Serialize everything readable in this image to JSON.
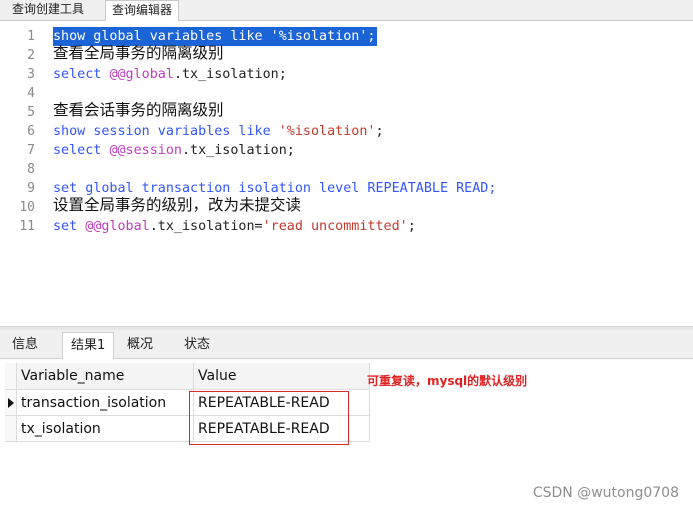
{
  "top_tabs": [
    "查询创建工具",
    "查询编辑器"
  ],
  "editor": {
    "line_numbers": [
      "1",
      "2",
      "3",
      "4",
      "5",
      "6",
      "7",
      "8",
      "9",
      "10",
      "11"
    ],
    "line1": "show global variables like '%isolation';",
    "line2": "查看全局事务的隔离级别",
    "line3": {
      "kw": "select ",
      "var": "@@global",
      "rest": ".tx_isolation;"
    },
    "line5": "查看会话事务的隔离级别",
    "line6": {
      "kw": "show session variables like ",
      "str": "'%isolation'",
      "rest": ";"
    },
    "line7": {
      "kw": "select ",
      "var": "@@session",
      "rest": ".tx_isolation;"
    },
    "line9": "set global transaction isolation level REPEATABLE READ;",
    "line10": "设置全局事务的级别，改为未提交读",
    "line11": {
      "kw": "set ",
      "var": "@@global",
      "rest": ".tx_isolation=",
      "str": "'read uncommitted'",
      "end": ";"
    }
  },
  "result_tabs": [
    "信息",
    "结果1",
    "概况",
    "状态"
  ],
  "result_grid": {
    "headers": [
      "Variable_name",
      "Value"
    ],
    "rows": [
      [
        "transaction_isolation",
        "REPEATABLE-READ"
      ],
      [
        "tx_isolation",
        "REPEATABLE-READ"
      ]
    ]
  },
  "annotation": "可重复读，mysql的默认级别",
  "watermark": "CSDN @wutong0708",
  "colors": {
    "selection": "#1a64d8",
    "keyword": "#3355ff",
    "variable": "#c03cc0",
    "string": "#c0392b",
    "annotation": "#e02424"
  }
}
